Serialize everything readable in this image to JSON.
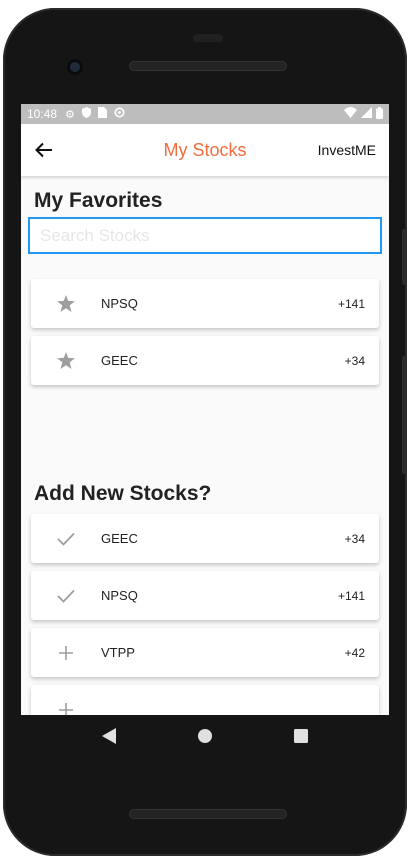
{
  "status_bar": {
    "time": "10:48"
  },
  "app_bar": {
    "title": "My Stocks",
    "brand": "InvestME"
  },
  "favorites": {
    "heading": "My Favorites",
    "search_placeholder": "Search Stocks",
    "items": [
      {
        "symbol": "NPSQ",
        "change": "+141",
        "icon": "star-icon"
      },
      {
        "symbol": "GEEC",
        "change": "+34",
        "icon": "star-icon"
      }
    ]
  },
  "add_new": {
    "heading": "Add New Stocks?",
    "items": [
      {
        "symbol": "GEEC",
        "change": "+34",
        "icon": "check-icon"
      },
      {
        "symbol": "NPSQ",
        "change": "+141",
        "icon": "check-icon"
      },
      {
        "symbol": "VTPP",
        "change": "+42",
        "icon": "plus-icon"
      }
    ]
  },
  "colors": {
    "accent": "#f26c3d",
    "search_border": "#2196f3",
    "icon_gray": "#9e9e9e",
    "status_bar": "#bdbdbd"
  }
}
